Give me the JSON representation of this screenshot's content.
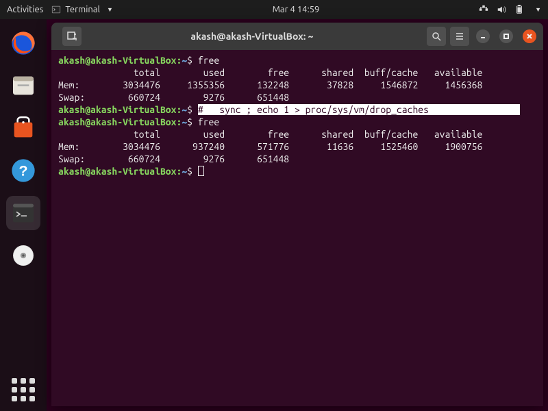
{
  "topbar": {
    "activities": "Activities",
    "app_menu": "Terminal",
    "clock": "Mar 4  14:59"
  },
  "dock_items": [
    "firefox",
    "files",
    "software",
    "help",
    "terminal",
    "disc"
  ],
  "window": {
    "title": "akash@akash-VirtualBox: ~"
  },
  "terminal": {
    "prompt_user": "akash@akash-VirtualBox",
    "prompt_path": "~",
    "prompt_suffix": "$",
    "commands": [
      "free",
      "#   sync ; echo 1 > proc/sys/vm/drop_caches",
      "free"
    ],
    "free_header": "              total        used        free      shared  buff/cache   available",
    "out1": {
      "mem": "Mem:        3034476     1355356      132248       37828     1546872     1456368",
      "swap": "Swap:        660724        9276      651448"
    },
    "out2": {
      "mem": "Mem:        3034476      937240      571776       11636     1525460     1900756",
      "swap": "Swap:        660724        9276      651448"
    }
  }
}
